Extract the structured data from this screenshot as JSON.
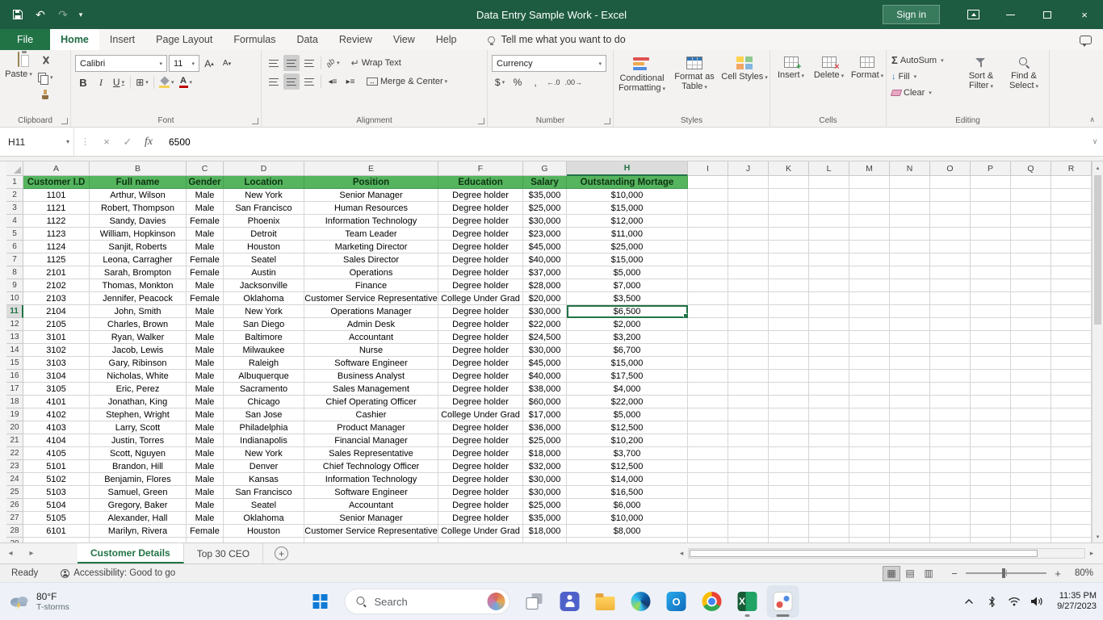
{
  "title_bar": {
    "title": "Data Entry Sample Work  -  Excel",
    "sign_in_label": "Sign in"
  },
  "ribbon_tabs": {
    "file": "File",
    "tabs": [
      "Home",
      "Insert",
      "Page Layout",
      "Formulas",
      "Data",
      "Review",
      "View",
      "Help"
    ],
    "tell_me": "Tell me what you want to do"
  },
  "ribbon": {
    "clipboard": {
      "group_label": "Clipboard",
      "paste_label": "Paste"
    },
    "font": {
      "group_label": "Font",
      "font_name": "Calibri",
      "font_size": "11",
      "bold": "B",
      "italic": "I",
      "underline": "U"
    },
    "alignment": {
      "group_label": "Alignment",
      "wrap_text": "Wrap Text",
      "merge_center": "Merge & Center"
    },
    "number": {
      "group_label": "Number",
      "format": "Currency",
      "currency_symbol": "$",
      "percent": "%",
      "comma": ","
    },
    "styles": {
      "group_label": "Styles",
      "conditional": "Conditional Formatting",
      "format_table": "Format as Table",
      "cell_styles": "Cell Styles"
    },
    "cells": {
      "group_label": "Cells",
      "insert": "Insert",
      "delete": "Delete",
      "format": "Format"
    },
    "editing": {
      "group_label": "Editing",
      "autosum_icon": "Σ",
      "autosum": "AutoSum",
      "fill": "Fill",
      "clear": "Clear",
      "sort_filter": "Sort & Filter",
      "find_select": "Find & Select"
    }
  },
  "formula_bar": {
    "name_box": "H11",
    "fx_icon": "fx",
    "formula_value": "6500"
  },
  "sheet": {
    "selected_cell": "H11",
    "columns": [
      "A",
      "B",
      "C",
      "D",
      "E",
      "F",
      "G",
      "H",
      "I",
      "J",
      "K",
      "L",
      "M",
      "N",
      "O",
      "P",
      "Q",
      "R"
    ],
    "header_row": [
      "Customer I.D",
      "Full name",
      "Gender",
      "Location",
      "Position",
      "Education",
      "Salary",
      "Outstanding Mortage"
    ],
    "rows": [
      [
        "1101",
        "Arthur, Wilson",
        "Male",
        "New York",
        "Senior Manager",
        "Degree holder",
        "$35,000",
        "$10,000"
      ],
      [
        "1121",
        "Robert, Thompson",
        "Male",
        "San Francisco",
        "Human Resources",
        "Degree holder",
        "$25,000",
        "$15,000"
      ],
      [
        "1122",
        "Sandy, Davies",
        "Female",
        "Phoenix",
        "Information Technology",
        "Degree holder",
        "$30,000",
        "$12,000"
      ],
      [
        "1123",
        "William, Hopkinson",
        "Male",
        "Detroit",
        "Team Leader",
        "Degree holder",
        "$23,000",
        "$11,000"
      ],
      [
        "1124",
        "Sanjit, Roberts",
        "Male",
        "Houston",
        "Marketing Director",
        "Degree holder",
        "$45,000",
        "$25,000"
      ],
      [
        "1125",
        "Leona, Carragher",
        "Female",
        "Seatel",
        "Sales Director",
        "Degree holder",
        "$40,000",
        "$15,000"
      ],
      [
        "2101",
        "Sarah, Brompton",
        "Female",
        "Austin",
        "Operations",
        "Degree holder",
        "$37,000",
        "$5,000"
      ],
      [
        "2102",
        "Thomas, Monkton",
        "Male",
        "Jacksonville",
        "Finance",
        "Degree holder",
        "$28,000",
        "$7,000"
      ],
      [
        "2103",
        "Jennifer, Peacock",
        "Female",
        "Oklahoma",
        "Customer Service Representative",
        "College Under Grad",
        "$20,000",
        "$3,500"
      ],
      [
        "2104",
        "John, Smith",
        "Male",
        "New York",
        "Operations Manager",
        "Degree holder",
        "$30,000",
        "$6,500"
      ],
      [
        "2105",
        "Charles, Brown",
        "Male",
        "San Diego",
        "Admin Desk",
        "Degree holder",
        "$22,000",
        "$2,000"
      ],
      [
        "3101",
        "Ryan, Walker",
        "Male",
        "Baltimore",
        "Accountant",
        "Degree holder",
        "$24,500",
        "$3,200"
      ],
      [
        "3102",
        "Jacob, Lewis",
        "Male",
        "Milwaukee",
        "Nurse",
        "Degree holder",
        "$30,000",
        "$6,700"
      ],
      [
        "3103",
        "Gary, Ribinson",
        "Male",
        "Raleigh",
        "Software Engineer",
        "Degree holder",
        "$45,000",
        "$15,000"
      ],
      [
        "3104",
        "Nicholas, White",
        "Male",
        "Albuquerque",
        "Business Analyst",
        "Degree holder",
        "$40,000",
        "$17,500"
      ],
      [
        "3105",
        "Eric, Perez",
        "Male",
        "Sacramento",
        "Sales Management",
        "Degree holder",
        "$38,000",
        "$4,000"
      ],
      [
        "4101",
        "Jonathan, King",
        "Male",
        "Chicago",
        "Chief Operating Officer",
        "Degree holder",
        "$60,000",
        "$22,000"
      ],
      [
        "4102",
        "Stephen, Wright",
        "Male",
        "San Jose",
        "Cashier",
        "College Under Grad",
        "$17,000",
        "$5,000"
      ],
      [
        "4103",
        "Larry, Scott",
        "Male",
        "Philadelphia",
        "Product Manager",
        "Degree holder",
        "$36,000",
        "$12,500"
      ],
      [
        "4104",
        "Justin, Torres",
        "Male",
        "Indianapolis",
        "Financial Manager",
        "Degree holder",
        "$25,000",
        "$10,200"
      ],
      [
        "4105",
        "Scott, Nguyen",
        "Male",
        "New York",
        "Sales Representative",
        "Degree holder",
        "$18,000",
        "$3,700"
      ],
      [
        "5101",
        "Brandon, Hill",
        "Male",
        "Denver",
        "Chief Technology Officer",
        "Degree holder",
        "$32,000",
        "$12,500"
      ],
      [
        "5102",
        "Benjamin, Flores",
        "Male",
        "Kansas",
        "Information Technology",
        "Degree holder",
        "$30,000",
        "$14,000"
      ],
      [
        "5103",
        "Samuel, Green",
        "Male",
        "San Francisco",
        "Software Engineer",
        "Degree holder",
        "$30,000",
        "$16,500"
      ],
      [
        "5104",
        "Gregory, Baker",
        "Male",
        "Seatel",
        "Accountant",
        "Degree holder",
        "$25,000",
        "$6,000"
      ],
      [
        "5105",
        "Alexander, Hall",
        "Male",
        "Oklahoma",
        "Senior Manager",
        "Degree holder",
        "$35,000",
        "$10,000"
      ],
      [
        "6101",
        "Marilyn, Rivera",
        "Female",
        "Houston",
        "Customer Service Representative",
        "College Under Grad",
        "$18,000",
        "$8,000"
      ]
    ]
  },
  "sheet_tabs": {
    "tabs": [
      "Customer Details",
      "Top 30 CEO"
    ]
  },
  "status_bar": {
    "mode": "Ready",
    "accessibility": "Accessibility: Good to go",
    "zoom": "80%"
  },
  "taskbar": {
    "weather_temp": "80°F",
    "weather_condition": "T-storms",
    "search_label": "Search",
    "time": "11:35 PM",
    "date": "9/27/2023"
  }
}
